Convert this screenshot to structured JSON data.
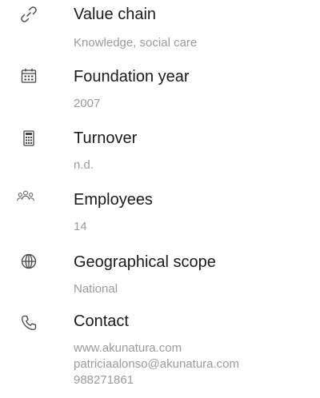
{
  "items": [
    {
      "icon": "link-icon",
      "label": "Value chain",
      "value": "Knowledge, social care"
    },
    {
      "icon": "calendar-icon",
      "label": "Foundation year",
      "value": "2007"
    },
    {
      "icon": "calculator-icon",
      "label": "Turnover",
      "value": "n.d."
    },
    {
      "icon": "people-icon",
      "label": "Employees",
      "value": "14"
    },
    {
      "icon": "globe-icon",
      "label": "Geographical scope",
      "value": "National"
    }
  ],
  "contact": {
    "icon": "phone-icon",
    "label": "Contact",
    "website": "www.akunatura.com",
    "email": "patriciaalonso@akunatura.com",
    "phone": "988271861"
  },
  "colors": {
    "title": "#1a1a1a",
    "subtitle": "#9a9a9a",
    "icon": "#444444"
  }
}
